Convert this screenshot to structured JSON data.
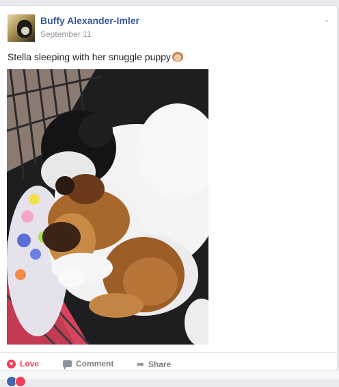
{
  "post": {
    "author": "Buffy Alexander-Imler",
    "date": "September 11",
    "text": "Stella sleeping with her snuggle puppy"
  },
  "actions": {
    "love_label": "Love",
    "comment_label": "Comment",
    "share_label": "Share"
  },
  "icons": {
    "more": "chevron-down-icon",
    "love": "heart-icon",
    "comment": "comment-icon",
    "share": "share-arrow-icon",
    "emoji": "dog-face-emoji"
  },
  "colors": {
    "link": "#365899",
    "love": "#f33e58",
    "muted": "#90949c"
  }
}
